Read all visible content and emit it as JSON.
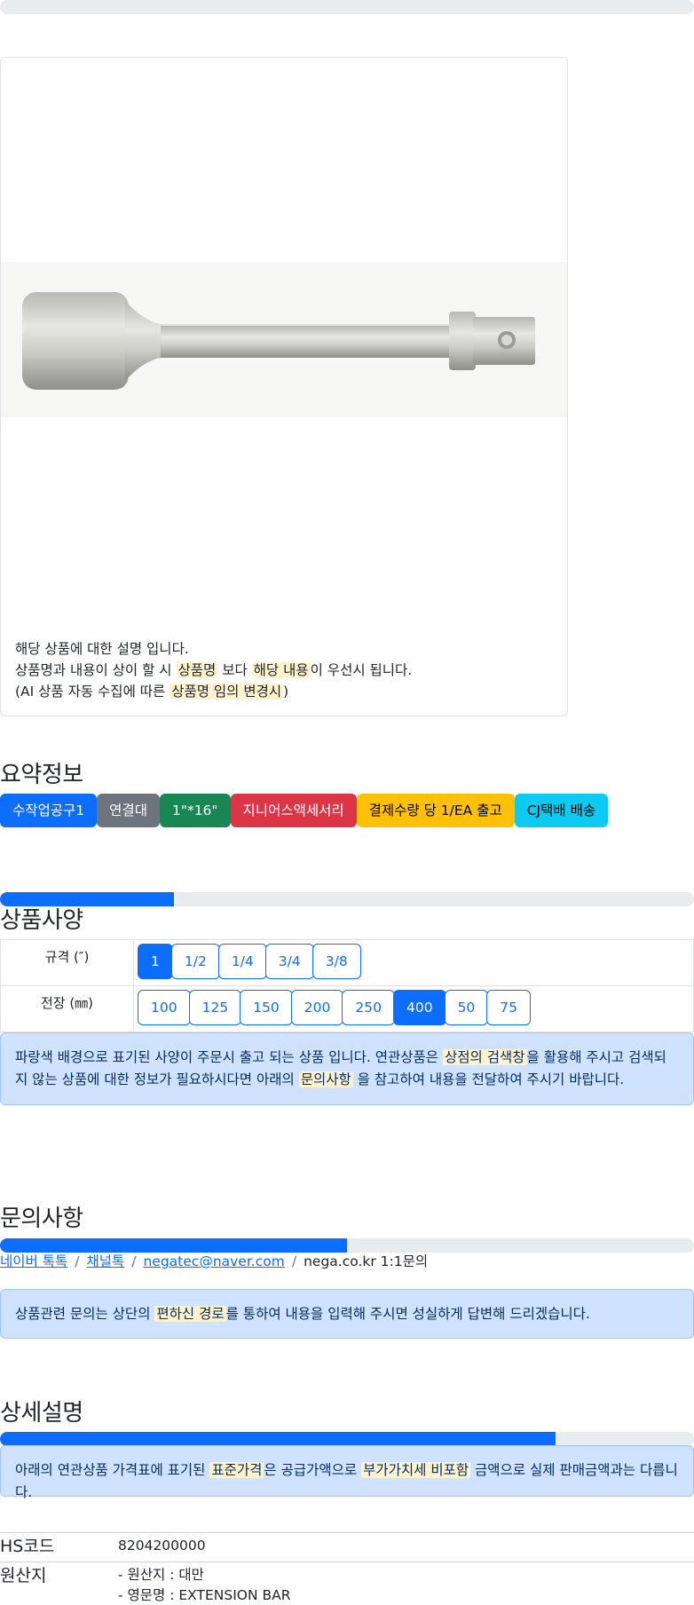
{
  "progress": {
    "top_bar": 0.0,
    "spec_bar": 0.25,
    "inquiry_bar": 0.5,
    "detail_bar": 0.8
  },
  "product_image": {
    "icon": "extension-bar-image"
  },
  "description": {
    "line1": "해당 상품에 대한 설명 입니다.",
    "line2_a": "상품명과 내용이 상이 할 시 ",
    "line2_hl1": "상품명",
    "line2_b": " 보다 ",
    "line2_hl2": "해당 내용",
    "line2_c": "이 우선시 됩니다.",
    "line3_a": "(AI 상품 자동 수집에 따른 ",
    "line3_hl": "상품명 임의 변경시",
    "line3_b": ")"
  },
  "summary": {
    "title": "요약정보",
    "badges": [
      {
        "label": "수작업공구1",
        "color": "#0d6efd"
      },
      {
        "label": "연결대",
        "color": "#6c757d"
      },
      {
        "label": "1\"*16\"",
        "color": "#198754"
      },
      {
        "label": "지니어스액세서리",
        "color": "#dc3545"
      },
      {
        "label": "결제수량 당 1/EA 출고",
        "color": "#ffc107"
      },
      {
        "label": "CJ택배 배송",
        "color": "#0dcaf0"
      }
    ]
  },
  "spec": {
    "title": "상품사양",
    "rows": [
      {
        "label": "규격 (″)",
        "options": [
          "1",
          "1/2",
          "1/4",
          "3/4",
          "3/8"
        ],
        "selected": "1"
      },
      {
        "label": "전장 (㎜)",
        "options": [
          "100",
          "125",
          "150",
          "200",
          "250",
          "400",
          "50",
          "75"
        ],
        "selected": "400"
      }
    ],
    "notice_a": "파랑색 배경으로 표기된 사양이 주문시 출고 되는 상품 입니다. 연관상품은 ",
    "notice_hl1": "상점의 검색창",
    "notice_b": "을 활용해 주시고 검색되지 않는 상품에 대한 정보가 필요하시다면 아래의 ",
    "notice_hl2": "문의사항",
    "notice_c": " 을 참고하여 내용을 전달하여 주시기 바랍니다."
  },
  "inquiry": {
    "title": "문의사항",
    "link_naver": "네이버 톡톡",
    "link_channel": "채널톡",
    "link_email": "negatec@naver.com",
    "site_text": "nega.co.kr 1:1문의",
    "sep": "/",
    "notice_a": "상품관련 문의는 상단의 ",
    "notice_hl": "편하신 경로",
    "notice_b": "를 통하여 내용을 입력해 주시면 성실하게 답변해 드리겠습니다."
  },
  "detail": {
    "title": "상세설명",
    "notice_a": "아래의 연관상품 가격표에 표기된 ",
    "notice_hl1": "표준가격",
    "notice_b": "은 공급가액으로 ",
    "notice_hl2": "부가가치세 비포함",
    "notice_c": " 금액으로 실제 판매금액과는 다릅니다.",
    "hs_label": "HS코드",
    "hs_value": "8204200000",
    "origin_label": "원산지",
    "origin_line1": "- 원산지 : 대만",
    "origin_line2": "- 영문명 : EXTENSION BAR"
  }
}
